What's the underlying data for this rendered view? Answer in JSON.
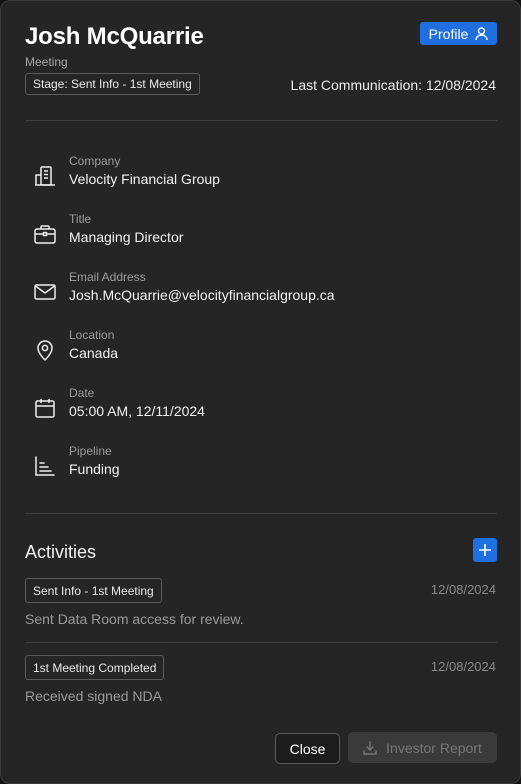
{
  "contact": {
    "name": "Josh McQuarrie",
    "subtitle": "Meeting",
    "stage": "Stage: Sent Info - 1st Meeting",
    "last_communication": "Last Communication: 12/08/2024"
  },
  "profile_button": {
    "label": "Profile",
    "icon": "user-icon"
  },
  "fields": [
    {
      "label": "Company",
      "value": "Velocity Financial Group",
      "icon": "building-icon"
    },
    {
      "label": "Title",
      "value": "Managing Director",
      "icon": "briefcase-icon"
    },
    {
      "label": "Email Address",
      "value": "Josh.McQuarrie@velocityfinancialgroup.ca",
      "icon": "mail-icon"
    },
    {
      "label": "Location",
      "value": "Canada",
      "icon": "map-pin-icon"
    },
    {
      "label": "Date",
      "value": "05:00 AM, 12/11/2024",
      "icon": "calendar-icon"
    },
    {
      "label": "Pipeline",
      "value": "Funding",
      "icon": "pipeline-chart-icon"
    }
  ],
  "activities": {
    "title": "Activities",
    "items": [
      {
        "tag": "Sent Info - 1st Meeting",
        "date": "12/08/2024",
        "description": "Sent Data Room access for review."
      },
      {
        "tag": "1st Meeting Completed",
        "date": "12/08/2024",
        "description": "Received signed NDA"
      }
    ]
  },
  "footer": {
    "close_label": "Close",
    "report_label": "Investor Report",
    "report_icon": "download-icon"
  },
  "colors": {
    "accent": "#1f6fe0",
    "card_bg": "#252525",
    "muted_text": "#9c9c9c"
  }
}
